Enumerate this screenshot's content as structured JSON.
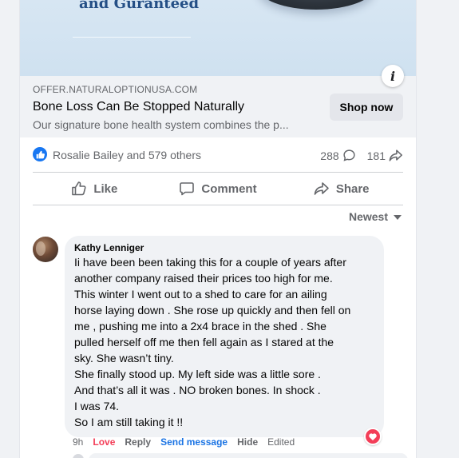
{
  "ad": {
    "headline": "and Guranteed",
    "info_icon": "info-icon"
  },
  "link": {
    "domain": "OFFER.NATURALOPTIONUSA.COM",
    "title": "Bone Loss Can Be Stopped Naturally",
    "description": "Our signature bone health system combines the p...",
    "cta": "Shop now"
  },
  "reactions": {
    "summary": "Rosalie Bailey and 579 others",
    "comments_count": "288",
    "shares_count": "181",
    "icons": [
      "like-icon",
      "comment-icon",
      "share-icon"
    ]
  },
  "actions": {
    "like": "Like",
    "comment": "Comment",
    "share": "Share"
  },
  "sort": {
    "label": "Newest"
  },
  "comment": {
    "author": "Kathy Lenniger",
    "lines": [
      "Ii have been been taking this for a couple of years after",
      "another company raised their prices too high for me.",
      "This winter I went out to a shed to care for an ailing",
      "horse laying down . She rose up quickly and then fell on",
      "me , pushing me into a 2x4 brace in the shed . She",
      "pulled herself off me then fell again as I stared at the",
      "sky. She wasn’t tiny.",
      "She finally stood up. My left side was a little sore .",
      "And that’s all it was . NO broken bones. In shock .",
      "I was 74.",
      "So I am still taking it !!"
    ],
    "time": "9h",
    "love": "Love",
    "reply": "Reply",
    "send_message": "Send message",
    "hide": "Hide",
    "edited": "Edited",
    "reaction_icon": "heart-icon"
  },
  "colors": {
    "accent": "#1877f2",
    "love": "#f33e58",
    "link": "#1b74e4",
    "muted": "#65676b"
  }
}
